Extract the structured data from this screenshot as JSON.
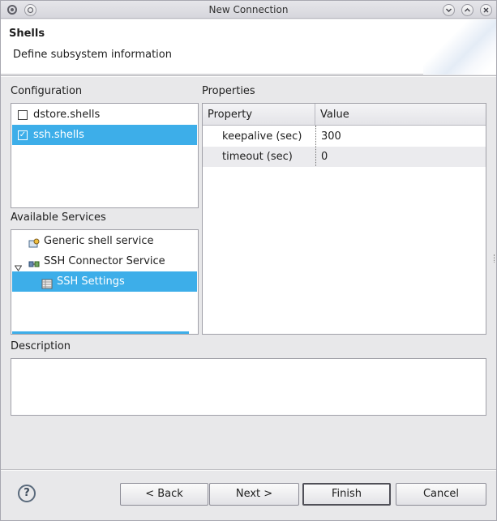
{
  "window": {
    "title": "New Connection"
  },
  "header": {
    "title": "Shells",
    "description": "Define subsystem information"
  },
  "configuration": {
    "label": "Configuration",
    "items": [
      {
        "label": "dstore.shells",
        "checked": false,
        "selected": false
      },
      {
        "label": "ssh.shells",
        "checked": true,
        "selected": true
      }
    ]
  },
  "services": {
    "label": "Available Services",
    "items": [
      {
        "label": "Generic shell service",
        "icon": "shell-service-icon",
        "level": 0
      },
      {
        "label": "SSH Connector Service",
        "icon": "connector-icon",
        "level": 0,
        "expanded": true
      },
      {
        "label": "SSH Settings",
        "icon": "settings-table-icon",
        "level": 1,
        "selected": true
      }
    ]
  },
  "properties": {
    "label": "Properties",
    "columns": [
      "Property",
      "Value"
    ],
    "rows": [
      {
        "property": "keepalive (sec)",
        "value": "300"
      },
      {
        "property": "timeout (sec)",
        "value": "0"
      }
    ]
  },
  "description": {
    "label": "Description",
    "text": ""
  },
  "buttons": {
    "help": "?",
    "back": "< Back",
    "next": "Next >",
    "finish": "Finish",
    "cancel": "Cancel"
  },
  "colors": {
    "selection": "#3daee9"
  }
}
